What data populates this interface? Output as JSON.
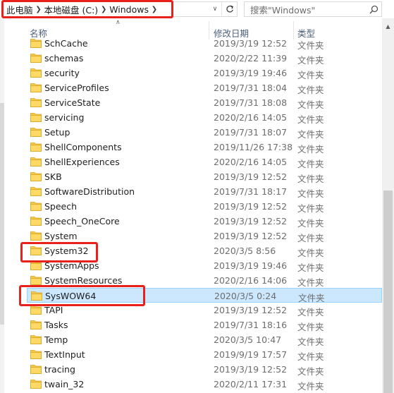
{
  "address": {
    "crumbs": [
      "此电脑",
      "本地磁盘 (C:)",
      "Windows"
    ]
  },
  "search": {
    "placeholder": "搜索\"Windows\""
  },
  "columns": {
    "name": "名称",
    "date": "修改日期",
    "type": "类型"
  },
  "rows": [
    {
      "name": "SchCache",
      "date": "2019/3/19 12:52",
      "type": "文件夹"
    },
    {
      "name": "schemas",
      "date": "2020/2/22 11:39",
      "type": "文件夹"
    },
    {
      "name": "security",
      "date": "2019/3/19 19:46",
      "type": "文件夹"
    },
    {
      "name": "ServiceProfiles",
      "date": "2019/7/31 18:04",
      "type": "文件夹"
    },
    {
      "name": "ServiceState",
      "date": "2019/7/31 18:08",
      "type": "文件夹"
    },
    {
      "name": "servicing",
      "date": "2020/2/16 14:05",
      "type": "文件夹"
    },
    {
      "name": "Setup",
      "date": "2019/7/31 18:07",
      "type": "文件夹"
    },
    {
      "name": "ShellComponents",
      "date": "2019/11/26 17:38",
      "type": "文件夹"
    },
    {
      "name": "ShellExperiences",
      "date": "2020/2/16 14:05",
      "type": "文件夹"
    },
    {
      "name": "SKB",
      "date": "2019/3/19 12:52",
      "type": "文件夹"
    },
    {
      "name": "SoftwareDistribution",
      "date": "2019/7/31 18:17",
      "type": "文件夹"
    },
    {
      "name": "Speech",
      "date": "2019/3/19 12:52",
      "type": "文件夹"
    },
    {
      "name": "Speech_OneCore",
      "date": "2019/3/19 12:52",
      "type": "文件夹"
    },
    {
      "name": "System",
      "date": "2019/3/19 12:52",
      "type": "文件夹"
    },
    {
      "name": "System32",
      "date": "2020/3/5 8:56",
      "type": "文件夹"
    },
    {
      "name": "SystemApps",
      "date": "2019/3/19 19:46",
      "type": "文件夹"
    },
    {
      "name": "SystemResources",
      "date": "2020/2/16 14:06",
      "type": "文件夹"
    },
    {
      "name": "SysWOW64",
      "date": "2020/3/5 0:24",
      "type": "文件夹",
      "selected": true
    },
    {
      "name": "TAPI",
      "date": "2019/3/19 12:52",
      "type": "文件夹"
    },
    {
      "name": "Tasks",
      "date": "2019/7/31 18:16",
      "type": "文件夹"
    },
    {
      "name": "Temp",
      "date": "2020/3/5 10:47",
      "type": "文件夹"
    },
    {
      "name": "TextInput",
      "date": "2019/9/19 17:57",
      "type": "文件夹"
    },
    {
      "name": "tracing",
      "date": "2019/3/19 12:52",
      "type": "文件夹"
    },
    {
      "name": "twain_32",
      "date": "2020/2/11 17:31",
      "type": "文件夹"
    }
  ],
  "colors": {
    "accent_red": "#e8211b",
    "selection": "#cce8ff",
    "folder": "#f6c94a"
  }
}
